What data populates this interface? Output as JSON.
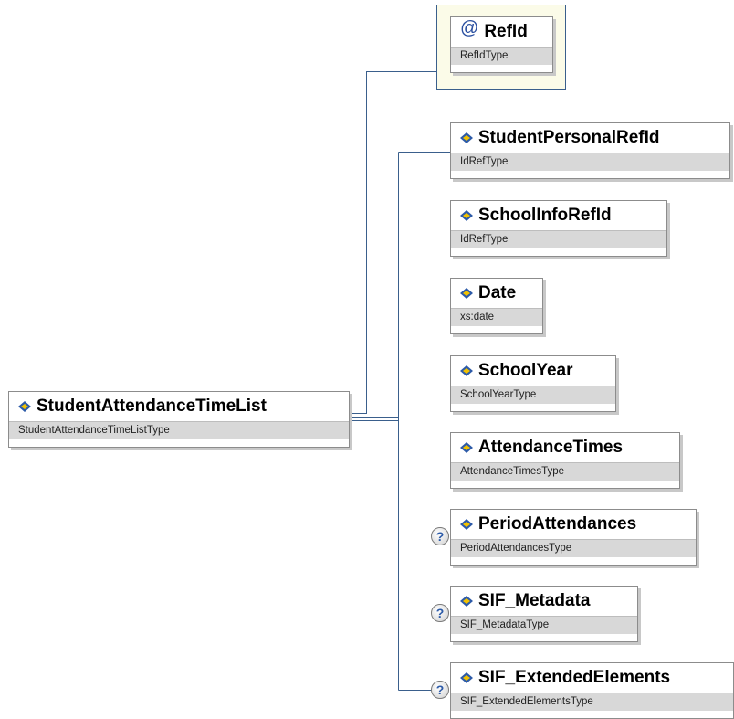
{
  "root": {
    "name": "StudentAttendanceTimeList",
    "type": "StudentAttendanceTimeListType"
  },
  "attribute": {
    "symbol": "@",
    "name": "RefId",
    "type": "RefIdType"
  },
  "elements": [
    {
      "name": "StudentPersonalRefId",
      "type": "IdRefType",
      "optional": false,
      "icon": "element-icon"
    },
    {
      "name": "SchoolInfoRefId",
      "type": "IdRefType",
      "optional": false,
      "icon": "element-icon"
    },
    {
      "name": "Date",
      "type": "xs:date",
      "optional": false,
      "icon": "element-icon"
    },
    {
      "name": "SchoolYear",
      "type": "SchoolYearType",
      "optional": false,
      "icon": "element-icon"
    },
    {
      "name": "AttendanceTimes",
      "type": "AttendanceTimesType",
      "optional": false,
      "icon": "element-icon"
    },
    {
      "name": "PeriodAttendances",
      "type": "PeriodAttendancesType",
      "optional": true,
      "icon": "element-icon"
    },
    {
      "name": "SIF_Metadata",
      "type": "SIF_MetadataType",
      "optional": true,
      "icon": "element-icon"
    },
    {
      "name": "SIF_ExtendedElements",
      "type": "SIF_ExtendedElementsType",
      "optional": true,
      "icon": "element-icon"
    }
  ],
  "optional_marker": "?",
  "colors": {
    "connector": "#3a5f8c",
    "type_bar": "#d8d8d8",
    "icon_blue": "#2d5ba8",
    "icon_yellow": "#f2c200"
  }
}
